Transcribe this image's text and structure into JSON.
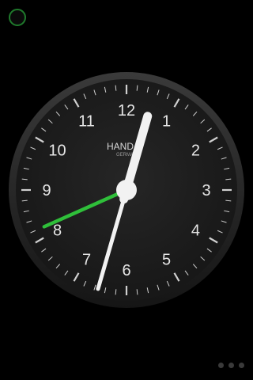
{
  "clock": {
    "brand": "HAND",
    "brand_sub": "GERMA",
    "numerals": [
      "12",
      "1",
      "2",
      "3",
      "4",
      "5",
      "6",
      "7",
      "8",
      "9",
      "10",
      "11"
    ],
    "time": {
      "hour": 12,
      "minute": 32,
      "second": 41
    },
    "colors": {
      "face": "#1d1d1d",
      "bezel": "#2b2b2b",
      "tick": "#cfcfcf",
      "numeral": "#e6e6e6",
      "hands": "#f2f2f2",
      "second_hand": "#2fbf3a",
      "corner_ring": "#1f7a2c"
    }
  },
  "controls": {
    "corner_button_icon": "settings-circle-icon",
    "page_indicator": {
      "count": 3,
      "active": 1
    }
  }
}
